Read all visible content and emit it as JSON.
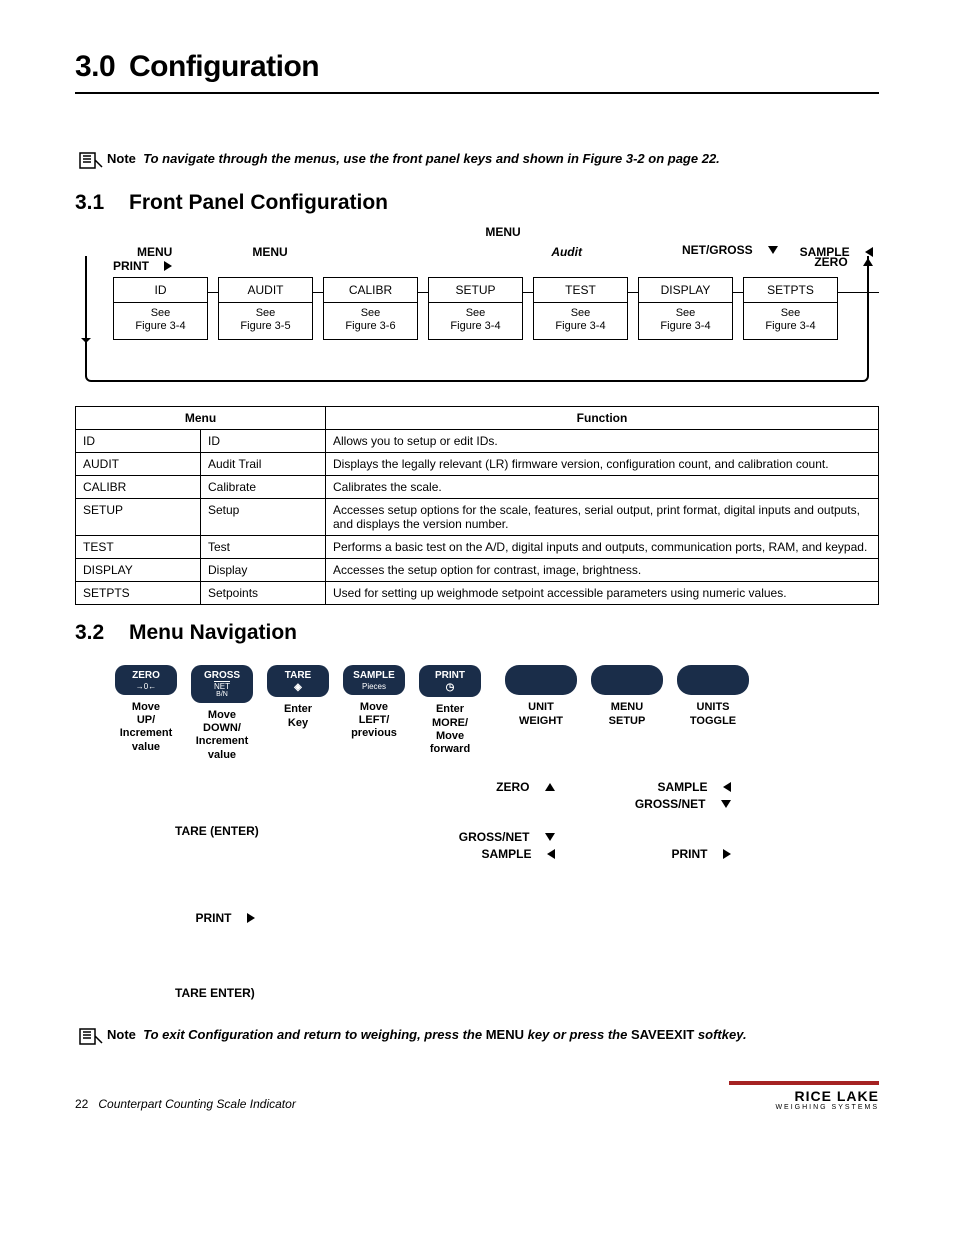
{
  "h1_num": "3.0",
  "h1_txt": "Configuration",
  "note1": {
    "label": "Note",
    "text": "To navigate through the menus, use the front panel keys and shown in Figure 3-2 on page 22."
  },
  "s31": {
    "num": "3.1",
    "title": "Front Panel Configuration"
  },
  "diagram": {
    "menu_top": "MENU",
    "left": {
      "l1": "MENU",
      "l2": "PRINT"
    },
    "mid": "MENU",
    "mid2": "Audit",
    "right": {
      "l1": "NET/GROSS",
      "l2": "SAMPLE",
      "l3": "ZERO"
    },
    "boxes": [
      {
        "t": "ID",
        "b": "See Figure 3-4"
      },
      {
        "t": "AUDIT",
        "b": "See Figure 3-5"
      },
      {
        "t": "CALIBR",
        "b": "See Figure 3-6"
      },
      {
        "t": "SETUP",
        "b": "See Figure 3-4"
      },
      {
        "t": "TEST",
        "b": "See Figure 3-4"
      },
      {
        "t": "DISPLAY",
        "b": "See Figure 3-4"
      },
      {
        "t": "SETPTS",
        "b": "See Figure 3-4"
      }
    ]
  },
  "table": {
    "h1": "Menu",
    "h2": "Function",
    "rows": [
      {
        "c1": "ID",
        "c2": "ID",
        "c3": "Allows you to setup or edit IDs."
      },
      {
        "c1": "AUDIT",
        "c2": "Audit Trail",
        "c3": "Displays the legally relevant (LR) firmware version, configuration count, and calibration count."
      },
      {
        "c1": "CALIBR",
        "c2": "Calibrate",
        "c3": "Calibrates the scale."
      },
      {
        "c1": "SETUP",
        "c2": "Setup",
        "c3": "Accesses setup options for the scale, features, serial output, print format, digital inputs and outputs, and displays the version number."
      },
      {
        "c1": "TEST",
        "c2": "Test",
        "c3": "Performs a basic test on the A/D, digital inputs and outputs, communication ports, RAM, and keypad."
      },
      {
        "c1": "DISPLAY",
        "c2": "Display",
        "c3": "Accesses the setup option for contrast, image, brightness."
      },
      {
        "c1": "SETPTS",
        "c2": "Setpoints",
        "c3": "Used for setting up weighmode setpoint accessible parameters using numeric values."
      }
    ]
  },
  "s32": {
    "num": "3.2",
    "title": "Menu Navigation"
  },
  "keys": [
    {
      "btn": {
        "l1": "ZERO",
        "l2": "→0←"
      },
      "lbl": "Move UP/ Increment value"
    },
    {
      "btn": {
        "l1": "GROSS",
        "l2": "NET",
        "l3": "B/N",
        "underline": true
      },
      "lbl": "Move DOWN/ Increment value"
    },
    {
      "btn": {
        "l1": "TARE",
        "sym": "dia"
      },
      "lbl": "Enter Key"
    },
    {
      "btn": {
        "l1": "SAMPLE",
        "l2": "Pieces"
      },
      "lbl": "Move LEFT/ previous"
    },
    {
      "btn": {
        "l1": "PRINT",
        "sym": "clock"
      },
      "lbl": "Enter MORE/ Move forward"
    }
  ],
  "ovalkeys": [
    {
      "l1": "UNIT",
      "l2": "WEIGHT"
    },
    {
      "l1": "MENU",
      "l2": "SETUP"
    },
    {
      "l1": "UNITS",
      "l2": "TOGGLE"
    }
  ],
  "nav2": {
    "tare": "TARE (ENTER)",
    "zero": "ZERO",
    "sample1": "SAMPLE",
    "grossnet1": "GROSS/NET",
    "print1": "PRINT",
    "grossnet2": "GROSS/NET",
    "sample2": "SAMPLE",
    "print2": "PRINT",
    "tare2": "TARE  ENTER)"
  },
  "note2": {
    "label": "Note",
    "pre": "To exit Configuration and return to weighing, press the ",
    "k1": "MENU",
    "mid": " key or press the ",
    "k2": "SAVEEXIT",
    "post": " softkey."
  },
  "footer": {
    "page": "22",
    "title": "Counterpart Counting Scale Indicator",
    "logo1": "RICE LAKE",
    "logo2": "WEIGHING SYSTEMS"
  }
}
